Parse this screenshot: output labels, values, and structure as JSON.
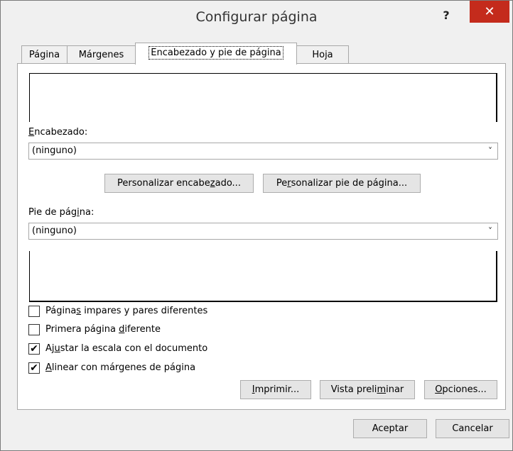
{
  "window": {
    "title": "Configurar página",
    "help_label": "?",
    "close_label": "✕"
  },
  "tabs": [
    {
      "label": "Página"
    },
    {
      "label": "Márgenes"
    },
    {
      "label": "Encabezado y pie de página"
    },
    {
      "label": "Hoja"
    }
  ],
  "header": {
    "label_pre": "",
    "label_u": "E",
    "label_post": "ncabezado:",
    "value": "(ninguno)",
    "custom_button_pre": "Personalizar encabe",
    "custom_button_u": "z",
    "custom_button_post": "ado..."
  },
  "footer": {
    "label_pre": "Pie de pág",
    "label_u": "i",
    "label_post": "na:",
    "value": "(ninguno)",
    "custom_button_pre": "Pe",
    "custom_button_u": "r",
    "custom_button_post": "sonalizar pie de página..."
  },
  "options": [
    {
      "pre": "Página",
      "u": "s",
      "post": " impares y pares diferentes",
      "checked": false
    },
    {
      "pre": "Primera página ",
      "u": "d",
      "post": "iferente",
      "checked": false
    },
    {
      "pre": "Aj",
      "u": "u",
      "post": "star la escala con el documento",
      "checked": true
    },
    {
      "pre": "",
      "u": "A",
      "post": "linear con márgenes de página",
      "checked": true
    }
  ],
  "buttons": {
    "print": {
      "pre": "",
      "u": "I",
      "post": "mprimir..."
    },
    "preview": {
      "pre": "Vista preli",
      "u": "m",
      "post": "inar"
    },
    "options": {
      "pre": "",
      "u": "O",
      "post": "pciones..."
    },
    "ok": "Aceptar",
    "cancel": "Cancelar"
  },
  "check_mark": "✔",
  "dropdown_arrow": "˅"
}
